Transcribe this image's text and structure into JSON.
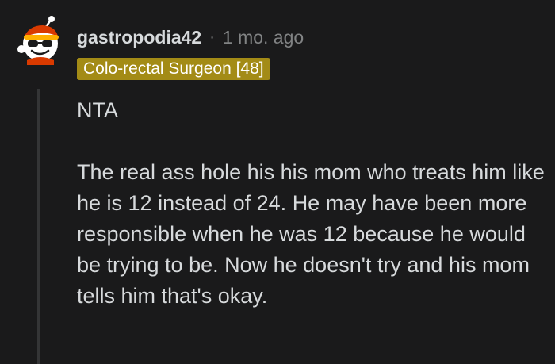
{
  "comment": {
    "author": "gastropodia42",
    "separator": "·",
    "timestamp": "1 mo. ago",
    "flair": "Colo-rectal Surgeon [48]",
    "flair_color": "#a38b16",
    "avatar_icon": "snoo-avatar-icon",
    "paragraphs": [
      "NTA",
      "The real ass hole his his mom who treats him like he is 12 instead of 24. He may have been more responsible when he was 12 because he would be trying to be. Now he doesn't try and his mom tells him that's okay."
    ]
  },
  "colors": {
    "background": "#1a1a1b",
    "text": "#d7dadc",
    "muted": "#818384",
    "thread_line": "#343536"
  }
}
